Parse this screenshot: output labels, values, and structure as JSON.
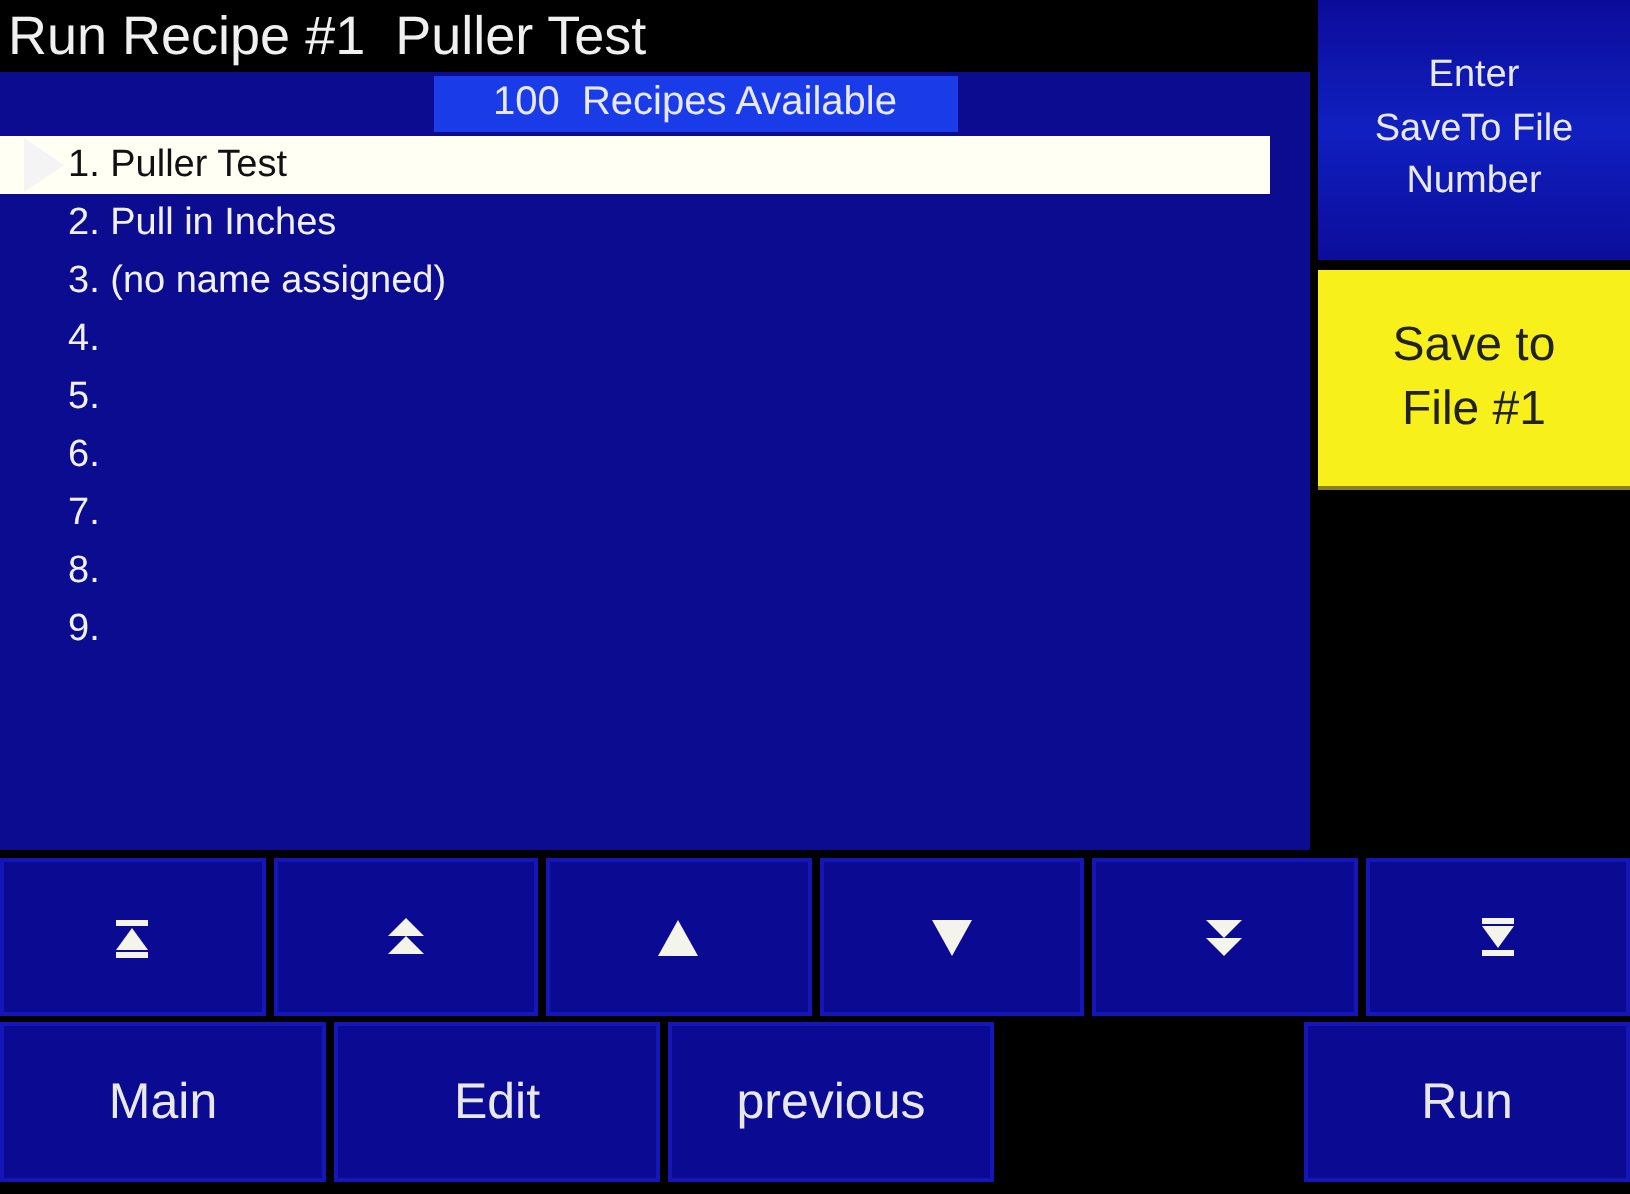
{
  "title": "Run Recipe #1  Puller Test",
  "list": {
    "header": "100  Recipes Available",
    "items": [
      {
        "label": "1. Puller Test",
        "selected": true
      },
      {
        "label": "2. Pull in Inches",
        "selected": false
      },
      {
        "label": "3. (no name assigned)",
        "selected": false
      },
      {
        "label": "4.",
        "selected": false
      },
      {
        "label": "5.",
        "selected": false
      },
      {
        "label": "6.",
        "selected": false
      },
      {
        "label": "7.",
        "selected": false
      },
      {
        "label": "8.",
        "selected": false
      },
      {
        "label": "9.",
        "selected": false
      }
    ]
  },
  "side_buttons": [
    {
      "kind": "blue",
      "label": "Enter\nSaveTo File\nNumber"
    },
    {
      "kind": "yellow",
      "label": "Save to\nFile #1"
    }
  ],
  "nav_buttons": [
    {
      "kind": "first"
    },
    {
      "kind": "page-up"
    },
    {
      "kind": "up"
    },
    {
      "kind": "down"
    },
    {
      "kind": "page-down"
    },
    {
      "kind": "last"
    }
  ],
  "bottom_buttons": [
    {
      "kind": "button",
      "label": "Main"
    },
    {
      "kind": "button",
      "label": "Edit"
    },
    {
      "kind": "button",
      "label": "previous"
    },
    {
      "kind": "empty"
    },
    {
      "kind": "button",
      "label": "Run"
    }
  ]
}
